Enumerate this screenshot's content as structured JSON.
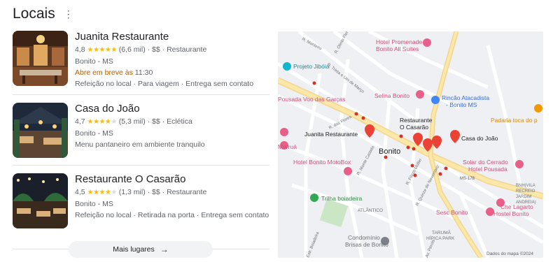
{
  "header": {
    "title": "Locais",
    "menu_icon": "⋮"
  },
  "places": [
    {
      "name": "Juanita Restaurante",
      "rating": "4,8",
      "reviews": "(6,6 mil)",
      "price": "$$",
      "category": "Restaurante",
      "location": "Bonito - MS",
      "status": "Abre em breve às",
      "status_time": "11:30",
      "services": "Refeição no local · Para viagem · Entrega sem contato",
      "stars_full": "★★★★★",
      "stars_half": ""
    },
    {
      "name": "Casa do João",
      "rating": "4,7",
      "reviews": "(5,3 mil)",
      "price": "$$",
      "category": "Eclética",
      "location": "Bonito - MS",
      "description": "Menu pantaneiro em ambiente tranquilo",
      "stars_full": "★★★★",
      "stars_half": "★"
    },
    {
      "name": "Restaurante O Casarão",
      "rating": "4,5",
      "reviews": "(1,3 mil)",
      "price": "$$",
      "category": "Restaurante",
      "location": "Bonito - MS",
      "services": "Refeição no local · Retirada na porta · Entrega sem contato",
      "stars_full": "★★★★",
      "stars_half": "★"
    }
  ],
  "more_button": {
    "label": "Mais lugares",
    "arrow": "→"
  },
  "map": {
    "streets": [
      "R. Monteiro",
      "R. Olinto Flores",
      "R. Trinta e Um de Março",
      "R. das Flores",
      "R. Monte Castelo",
      "R. Filinto Müller",
      "R. Quinze de Novembro",
      "Estr. Boiadeira",
      "Av. Pérola",
      "MS-178"
    ],
    "labels": {
      "hotel_promenade": "Hotel Promenade Bonito All Suites",
      "hotel_promenade_1": "Hotel Promenade",
      "hotel_promenade_2": "Bonito All Suites",
      "projeto_jiboia": "Projeto Jibóia",
      "selina": "Selina Bonito",
      "rincao_1": "Rincão Atacadista",
      "rincao_2": "- Bonito MS",
      "padaria": "Padaria toca do p",
      "pousada_1": "Pousada Voo das Garças",
      "juanita": "Juanita Restaurante",
      "casarao_1": "Restaurante",
      "casarao_2": "O Casarão",
      "casa_joao": "Casa do João",
      "marrua": "Marruá",
      "bonito": "Bonito",
      "motobox": "Hotel Bonito MotoBox",
      "solar_1": "Solar do Cerrado",
      "solar_2": "Hotel Pousada",
      "trilha": "Trilha boiadeira",
      "atlantico": "ATLÂNTICO",
      "bnh_1": "BNH(VILA",
      "bnh_2": "RECREIO",
      "bnh_3": "JARDIM",
      "bnh_4": "ANDREIA)",
      "sesc": "Sesc Bonito",
      "che_1": "Che Lagarto",
      "che_2": "Hostel Bonito",
      "taruma_1": "TARUMÃ",
      "taruma_2": "HÍPICA PARK",
      "condominio_1": "Condomínio",
      "condominio_2": "Brisas de Bonito",
      "copyright": "Dados do mapa ©2024"
    }
  },
  "colors": {
    "accent_star": "#fbbc04",
    "open_status": "#b06000",
    "pin_red": "#ea4335",
    "hotel_pink": "#e8608a",
    "map_bg": "#eef0f3"
  }
}
